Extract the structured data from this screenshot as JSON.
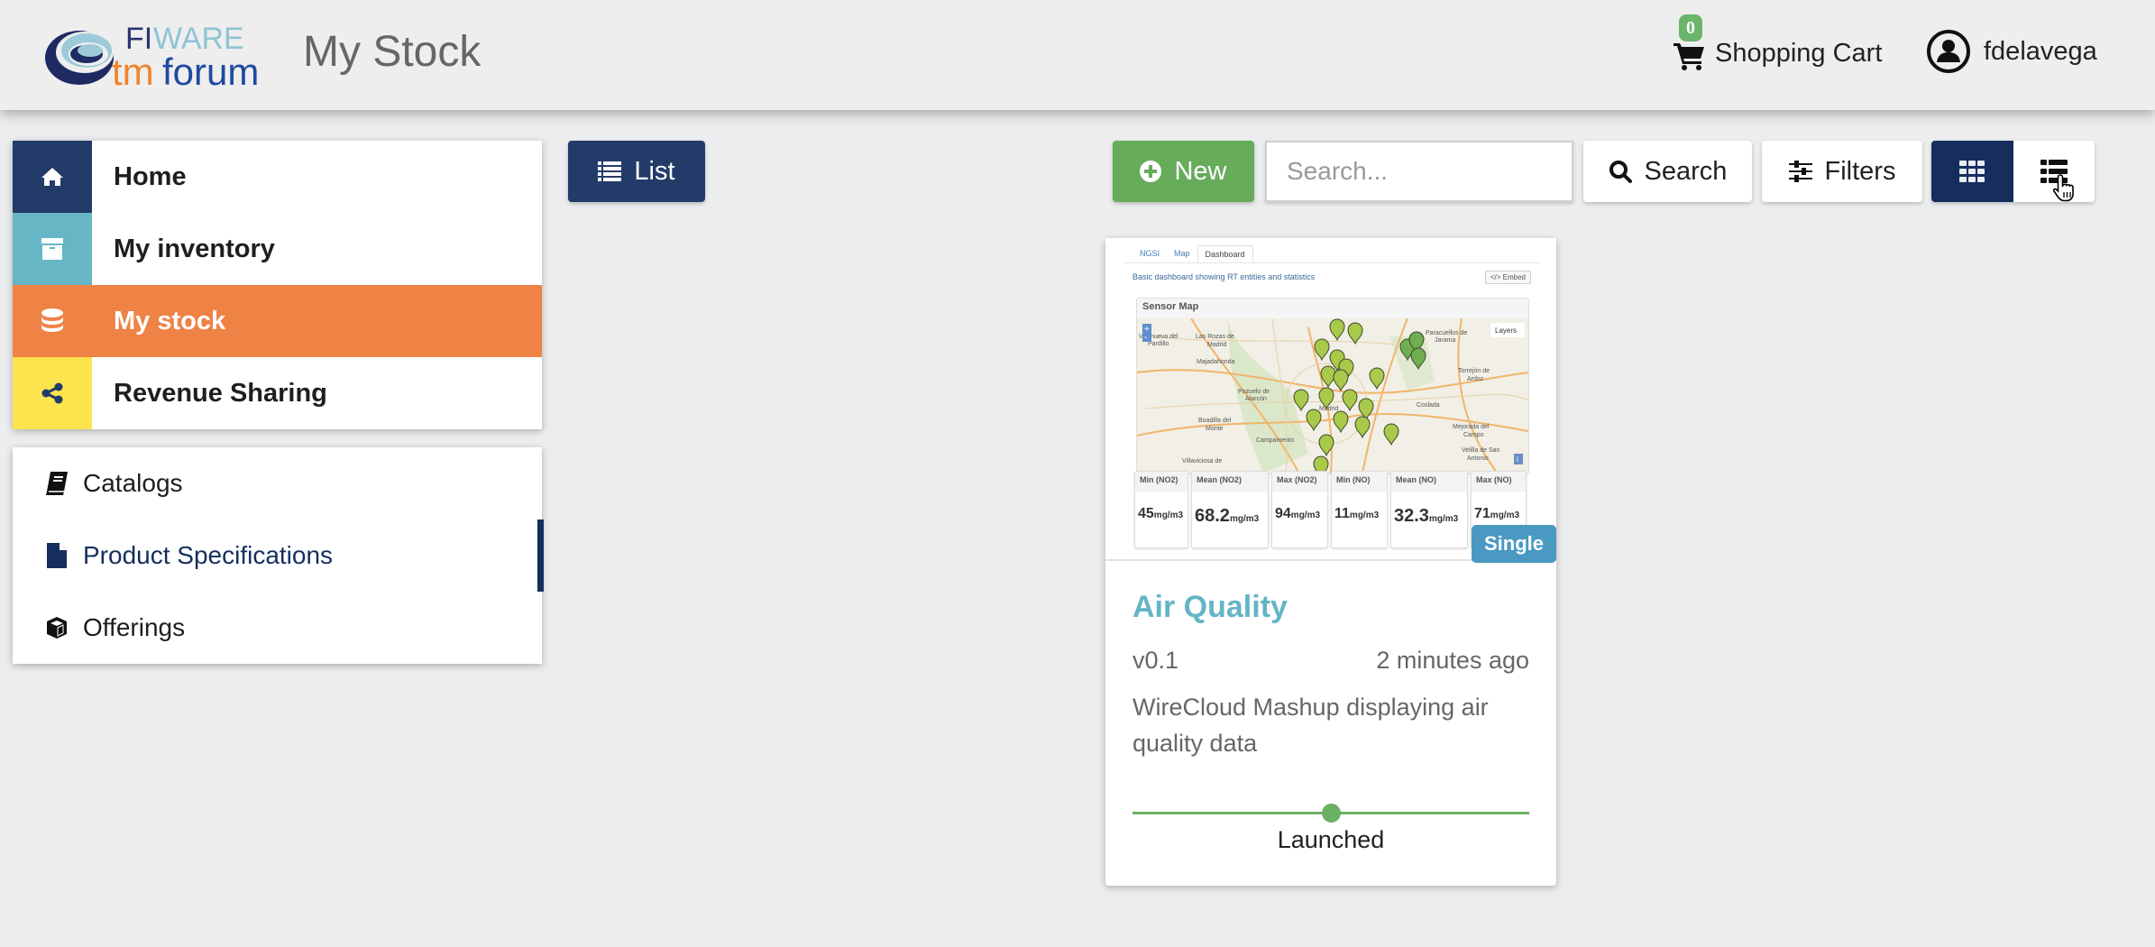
{
  "header": {
    "logo_alt": "FIWARE tmforum",
    "page_title": "My Stock",
    "cart": {
      "label": "Shopping Cart",
      "count": "0",
      "badge_color": "#6ab56a"
    },
    "user": {
      "name": "fdelavega"
    }
  },
  "sidebar": {
    "main_items": [
      {
        "label": "Home",
        "icon": "home-icon",
        "color": "#233b69",
        "active": false
      },
      {
        "label": "My inventory",
        "icon": "archive-icon",
        "color": "#66b6c6",
        "active": false
      },
      {
        "label": "My stock",
        "icon": "database-icon",
        "color": "#ef8245",
        "active": true
      },
      {
        "label": "Revenue Sharing",
        "icon": "share-icon",
        "color": "#fce44f",
        "active": false
      }
    ],
    "sub_items": [
      {
        "label": "Catalogs",
        "icon": "book-icon",
        "selected": false
      },
      {
        "label": "Product Specifications",
        "icon": "file-icon",
        "selected": true
      },
      {
        "label": "Offerings",
        "icon": "cube-icon",
        "selected": false
      }
    ]
  },
  "toolbar": {
    "list_label": "List",
    "new_label": "New",
    "search_placeholder": "Search...",
    "search_value": "",
    "search_label": "Search",
    "filters_label": "Filters",
    "view_modes": [
      {
        "name": "grid",
        "icon": "grid-icon",
        "active": true
      },
      {
        "name": "list",
        "icon": "list-icon",
        "active": false
      }
    ]
  },
  "products": [
    {
      "name": "Air Quality",
      "version": "v0.1",
      "updated": "2 minutes ago",
      "description": "WireCloud Mashup displaying air quality data",
      "badge": "Single",
      "lifecycle_status": "Launched",
      "lifecycle_progress": 0.5,
      "thumbnail": {
        "tabs": [
          "NGSI",
          "Map",
          "Dashboard"
        ],
        "active_tab": "Dashboard",
        "description": "Basic dashboard showing RT entities and statistics",
        "embed_label": "</> Embed",
        "map_title": "Sensor Map",
        "layers_label": "Layers",
        "place_labels": [
          "Villanueva del Pardillo",
          "Las Rozas de Madrid",
          "Majadahonda",
          "Pozuelo de Alarcón",
          "Boadilla del Monte",
          "Campamento",
          "Villaviciosa de Odón",
          "Paracuellos de Jarama",
          "Torrejón de Ardoz",
          "Coslada",
          "Mejorada del Campo",
          "Velilla de San Antonio",
          "Madrid"
        ],
        "stats": [
          {
            "label": "Min (NO2)",
            "value": "45",
            "unit": "mg/m3"
          },
          {
            "label": "Mean (NO2)",
            "value": "68.2",
            "unit": "mg/m3"
          },
          {
            "label": "Max (NO2)",
            "value": "94",
            "unit": "mg/m3"
          },
          {
            "label": "Min (NO)",
            "value": "11",
            "unit": "mg/m3"
          },
          {
            "label": "Mean (NO)",
            "value": "32.3",
            "unit": "mg/m3"
          },
          {
            "label": "Max (NO)",
            "value": "71",
            "unit": "mg/m3"
          }
        ]
      }
    }
  ]
}
